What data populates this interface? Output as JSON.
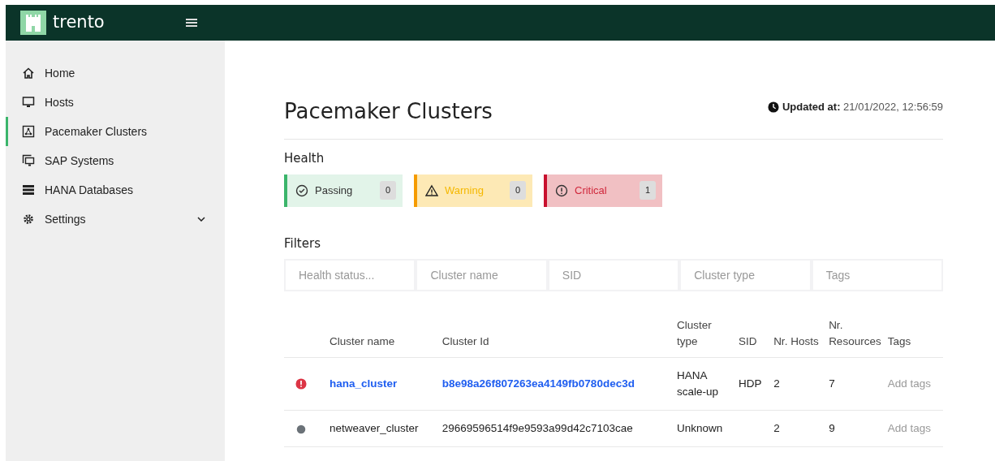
{
  "brand": {
    "name": "trento"
  },
  "sidebar": {
    "items": [
      {
        "label": "Home",
        "selected": false
      },
      {
        "label": "Hosts",
        "selected": false
      },
      {
        "label": "Pacemaker Clusters",
        "selected": true
      },
      {
        "label": "SAP Systems",
        "selected": false
      },
      {
        "label": "HANA Databases",
        "selected": false
      },
      {
        "label": "Settings",
        "selected": false,
        "expandable": true
      }
    ]
  },
  "page": {
    "title": "Pacemaker Clusters",
    "updated_label": "Updated at:",
    "updated_value": "21/01/2022, 12:56:59"
  },
  "health": {
    "title": "Health",
    "items": [
      {
        "kind": "passing",
        "label": "Passing",
        "count": "0"
      },
      {
        "kind": "warning",
        "label": "Warning",
        "count": "0"
      },
      {
        "kind": "critical",
        "label": "Critical",
        "count": "1"
      }
    ]
  },
  "filters": {
    "title": "Filters",
    "fields": [
      {
        "placeholder": "Health status..."
      },
      {
        "placeholder": "Cluster name"
      },
      {
        "placeholder": "SID"
      },
      {
        "placeholder": "Cluster type"
      },
      {
        "placeholder": "Tags"
      }
    ]
  },
  "table": {
    "columns": [
      "Cluster name",
      "Cluster Id",
      "Cluster type",
      "SID",
      "Nr. Hosts",
      "Nr. Resources",
      "Tags"
    ],
    "rows": [
      {
        "kind": "critical",
        "link": true,
        "cells": [
          "hana_cluster",
          "b8e98a26f807263ea4149fb0780dec3d",
          "HANA scale-up",
          "HDP",
          "2",
          "7"
        ],
        "tags": "Add tags"
      },
      {
        "kind": "unknown",
        "link": false,
        "cells": [
          "netweaver_cluster",
          "29669596514f9e9593a99d42c7103cae",
          "Unknown",
          "",
          "2",
          "9"
        ],
        "tags": "Add tags"
      }
    ]
  }
}
